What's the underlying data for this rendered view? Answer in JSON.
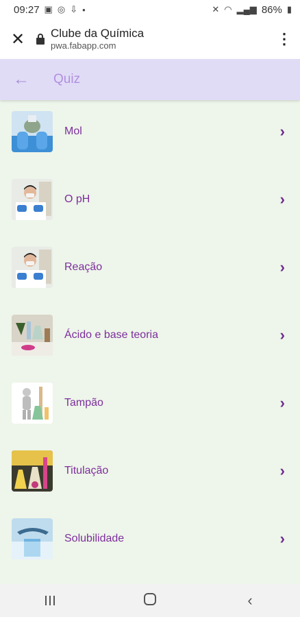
{
  "status": {
    "time": "09:27",
    "battery": "86%"
  },
  "browser": {
    "title": "Clube da Química",
    "domain": "pwa.fabapp.com"
  },
  "appbar": {
    "title": "Quiz"
  },
  "items": [
    {
      "label": "Mol",
      "icon": "lab-gloves-thumbnail"
    },
    {
      "label": "O pH",
      "icon": "lab-technician-thumbnail"
    },
    {
      "label": "Reação",
      "icon": "lab-technician-thumbnail"
    },
    {
      "label": "Ácido e base teoria",
      "icon": "lab-glassware-thumbnail"
    },
    {
      "label": "Tampão",
      "icon": "figure-with-flasks-thumbnail"
    },
    {
      "label": "Titulação",
      "icon": "titration-flasks-thumbnail"
    },
    {
      "label": "Solubilidade",
      "icon": "water-glass-thumbnail"
    }
  ],
  "colors": {
    "appbar": "#e0dcf6",
    "accent": "#b18fe0",
    "label": "#7c2e9c",
    "background": "#eef5ea"
  }
}
